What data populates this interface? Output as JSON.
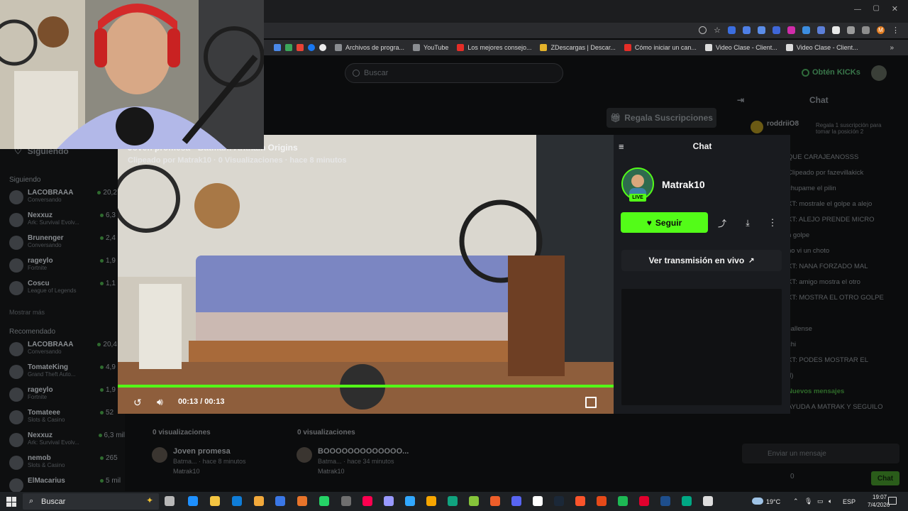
{
  "browser": {
    "bookmarks": [
      {
        "label": "Archivos de progra...",
        "color": "#8a8d91"
      },
      {
        "label": "YouTube",
        "color": "#8a8d91"
      },
      {
        "label": "Los mejores consejo...",
        "color": "#e52d27"
      },
      {
        "label": "ZDescargas | Descar...",
        "color": "#e4b22a"
      },
      {
        "label": "Cómo iniciar un can...",
        "color": "#e52d27"
      },
      {
        "label": "Video Clase - Client...",
        "color": "#dcdcdc"
      },
      {
        "label": "Video Clase - Client...",
        "color": "#dcdcdc"
      }
    ],
    "profile_initial": "M"
  },
  "header": {
    "search_placeholder": "Buscar",
    "kicks_label": "Obtén KICKs"
  },
  "sidebar": {
    "following_title": "Siguiendo",
    "following_section": "Siguiendo",
    "following": [
      {
        "name": "LACOBRAAA",
        "sub": "Conversando",
        "count": "20,2 m"
      },
      {
        "name": "Nexxuz",
        "sub": "Ark: Survival Evolv...",
        "count": "6,3 m"
      },
      {
        "name": "Brunenger",
        "sub": "Conversando",
        "count": "2,4 m"
      },
      {
        "name": "rageylo",
        "sub": "Fortnite",
        "count": "1,9 m"
      },
      {
        "name": "Coscu",
        "sub": "League of Legends",
        "count": "1,1 m"
      }
    ],
    "show_more": "Mostrar más",
    "recommended_section": "Recomendado",
    "recommended": [
      {
        "name": "LACOBRAAA",
        "sub": "Conversando",
        "count": "20,4 m"
      },
      {
        "name": "TomateKing",
        "sub": "Grand Theft Auto...",
        "count": "4,9 m"
      },
      {
        "name": "rageylo",
        "sub": "Fortnite",
        "count": "1,9 m"
      },
      {
        "name": "Tomateee",
        "sub": "Slots & Casino",
        "count": "52"
      },
      {
        "name": "Nexxuz",
        "sub": "Ark: Survival Evolv...",
        "count": "6,3 mil"
      },
      {
        "name": "nemob",
        "sub": "Slots & Casino",
        "count": "265"
      },
      {
        "name": "ElMacarius",
        "sub": "",
        "count": "5 mil"
      }
    ]
  },
  "page": {
    "gift_button": "Regala Suscripciones",
    "chat_header": "Chat",
    "bg_chat_top": "roddriiO8",
    "bg_chat_top_sub": "Regala 1 suscripción para tomar la posición 2",
    "bg_chat_lines": [
      "QUE CARAJEANOSSS",
      "Clipeado por fazevillakick",
      "chupame el pilin",
      "XT: mostrale el golpe a alejo",
      "XT: ALEJO PRENDE MICRO",
      "n golpe",
      "no vi un choto",
      "XT: NANA FORZADO MAL",
      "XT: amigo mostra el otro",
      "XT: MOSTRA EL OTRO GOLPE",
      "",
      "callense",
      "chi",
      "XT: PODES MOSTRAR EL",
      "d)",
      "Nuevos mensajes",
      "AYUDA A MATRAK Y SEGUILO"
    ],
    "chat_input_placeholder": "Enviar un mensaje",
    "chat_send": "Chat",
    "chat_count": "0",
    "bg_clips": [
      {
        "views": "0 visualizaciones",
        "title": "Joven promesa",
        "meta": "Batma... · hace 8 minutos",
        "channel": "Matrak10"
      },
      {
        "views": "0 visualizaciones",
        "title": "BOOOOOOOOOOOOO...",
        "meta": "Batma... · hace 34 minutos",
        "channel": "Matrak10"
      }
    ]
  },
  "clip": {
    "title": "Joven promesa - Batman: Arkham Origins",
    "meta": "Clipeado por Matrak10 · 0 Visualizaciones · hace 8 minutos",
    "time": "00:13 / 00:13",
    "progress": 1.0
  },
  "panel": {
    "chat_label": "Chat",
    "channel_name": "Matrak10",
    "live_badge": "LIVE",
    "follow_label": "Seguir",
    "live_link": "Ver transmisión en vivo"
  },
  "taskbar": {
    "search_placeholder": "Buscar",
    "weather": "19°C",
    "lang": "ESP",
    "time": "19:07",
    "date": "7/4/2026"
  },
  "colors": {
    "kick_green": "#53fc18",
    "background": "#0b0c0d",
    "panel": "#191b1f"
  }
}
